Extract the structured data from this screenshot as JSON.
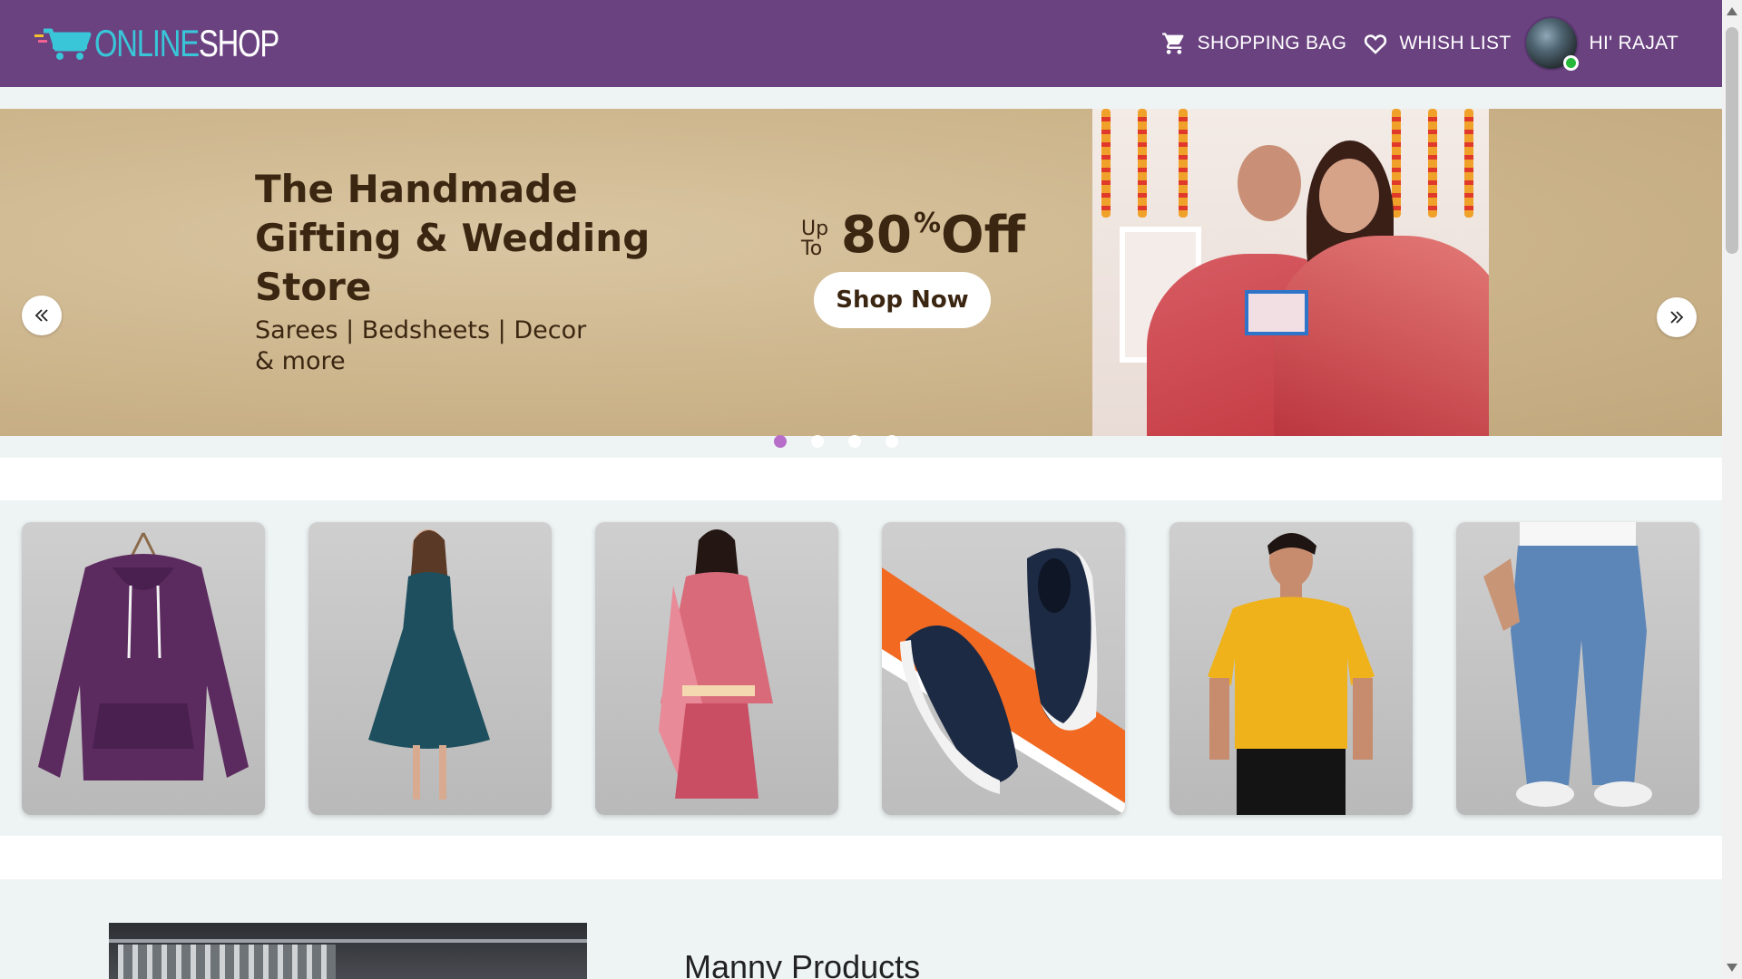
{
  "header": {
    "logo": {
      "part1": "ONLINE",
      "part2": "SHOP",
      "icon": "shopping-cart-icon"
    },
    "shopping_bag": {
      "label": "SHOPPING BAG",
      "icon": "cart-icon"
    },
    "wish_list": {
      "label": "WHISH LIST",
      "icon": "heart-icon"
    },
    "user": {
      "greeting": "HI' RAJAT",
      "status": "online"
    }
  },
  "banner": {
    "title": "The Handmade Gifting & Wedding Store",
    "subtitle": "Sarees | Bedsheets | Decor & more",
    "offer_prefix": "Up To",
    "offer_value": "80",
    "offer_symbol": "%",
    "offer_suffix": "Off",
    "cta": "Shop Now",
    "slide_count": 4,
    "active_slide": 1
  },
  "categories": [
    {
      "name": "hoodie",
      "color": "#5b2a5f"
    },
    {
      "name": "dress",
      "color": "#1e4f5e"
    },
    {
      "name": "kurta-set",
      "color": "#d96a7a"
    },
    {
      "name": "sneakers",
      "color": "#1d2a44"
    },
    {
      "name": "t-shirt",
      "color": "#f0b21a"
    },
    {
      "name": "jeans",
      "color": "#5d86b8"
    }
  ],
  "products": {
    "title": "Manny Products"
  },
  "colors": {
    "nav": "#6a4280",
    "logo_accent": "#38c6d8",
    "active_dot": "#b66ec8",
    "online": "#27b83b"
  }
}
